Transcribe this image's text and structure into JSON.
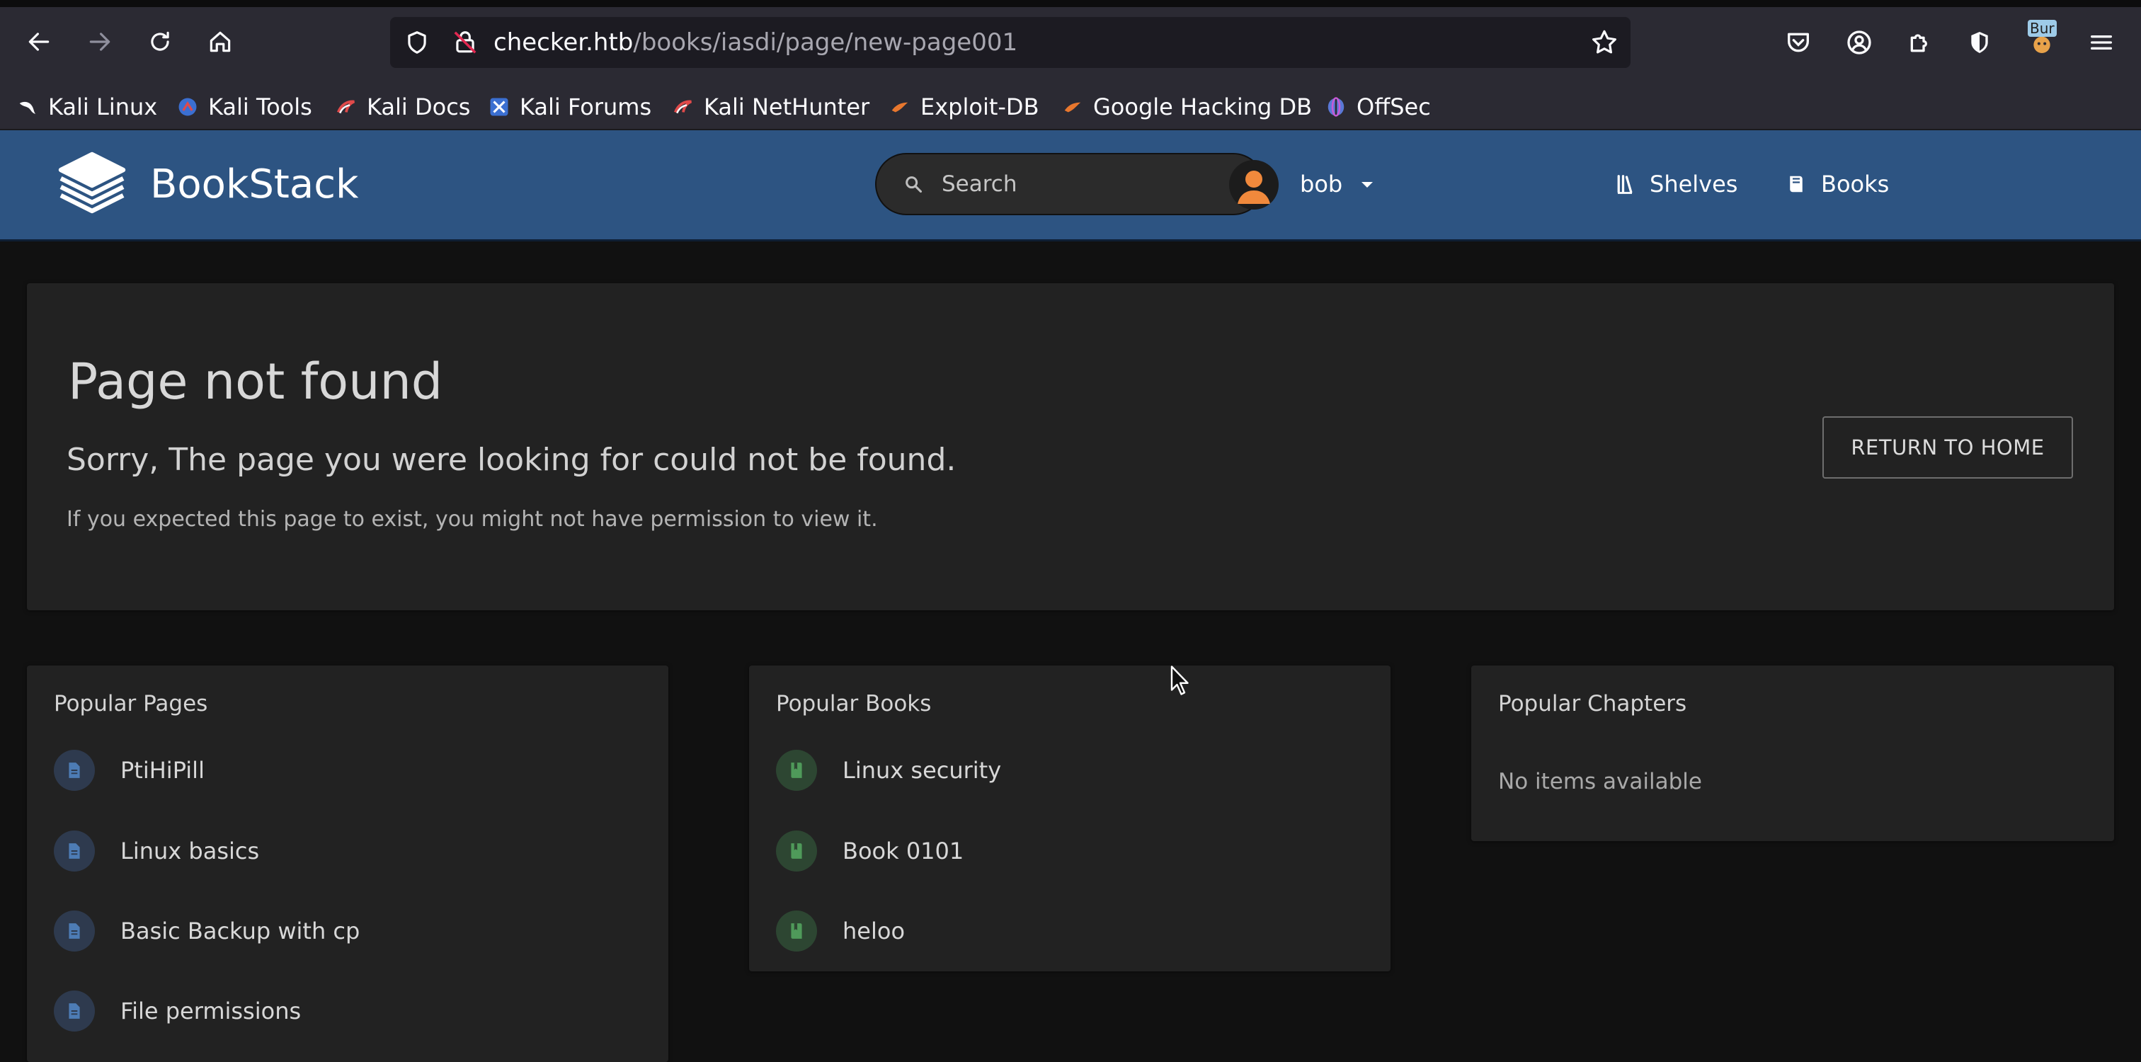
{
  "browser": {
    "url_host": "checker.htb",
    "url_path": "/books/iasdi/page/new-page001",
    "extension_badge": "Bur",
    "bookmarks": [
      {
        "label": "Kali Linux",
        "icon": "kali-dragon-icon"
      },
      {
        "label": "Kali Tools",
        "icon": "kali-tools-icon"
      },
      {
        "label": "Kali Docs",
        "icon": "kali-docs-icon"
      },
      {
        "label": "Kali Forums",
        "icon": "kali-forums-icon"
      },
      {
        "label": "Kali NetHunter",
        "icon": "kali-nethunter-icon"
      },
      {
        "label": "Exploit-DB",
        "icon": "exploit-db-icon"
      },
      {
        "label": "Google Hacking DB",
        "icon": "ghdb-icon"
      },
      {
        "label": "OffSec",
        "icon": "offsec-icon"
      }
    ]
  },
  "header": {
    "app_name": "BookStack",
    "search_placeholder": "Search",
    "nav": {
      "shelves": "Shelves",
      "books": "Books"
    },
    "user": "bob"
  },
  "error": {
    "title": "Page not found",
    "subtitle": "Sorry, The page you were looking for could not be found.",
    "note": "If you expected this page to exist, you might not have permission to view it.",
    "return_label": "RETURN TO HOME"
  },
  "popular_pages": {
    "title": "Popular Pages",
    "items": [
      "PtiHiPill",
      "Linux basics",
      "Basic Backup with cp",
      "File permissions"
    ]
  },
  "popular_books": {
    "title": "Popular Books",
    "items": [
      "Linux security",
      "Book 0101",
      "heloo"
    ]
  },
  "popular_chapters": {
    "title": "Popular Chapters",
    "empty": "No items available"
  },
  "colors": {
    "header_bg": "#2d5482",
    "page_bg": "#111111",
    "card_bg": "#222222",
    "page_icon": "#4d7cb5",
    "book_icon": "#4f9a5a"
  }
}
